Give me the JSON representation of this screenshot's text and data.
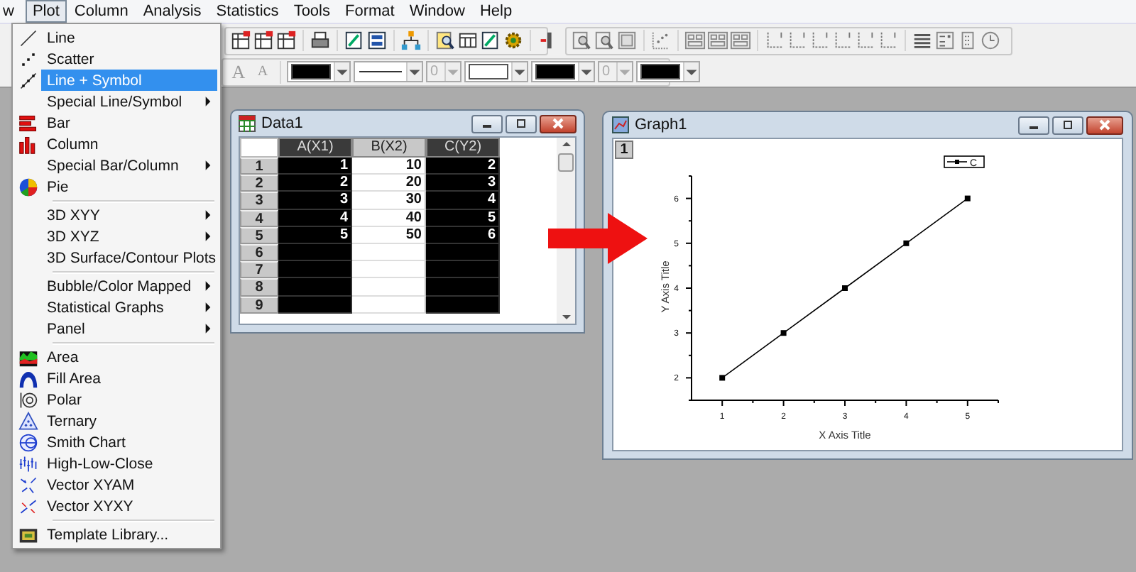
{
  "menubar": [
    {
      "label": "w",
      "selected": false
    },
    {
      "label": "Plot",
      "selected": true
    },
    {
      "label": "Column",
      "selected": false
    },
    {
      "label": "Analysis",
      "selected": false
    },
    {
      "label": "Statistics",
      "selected": false
    },
    {
      "label": "Tools",
      "selected": false
    },
    {
      "label": "Format",
      "selected": false
    },
    {
      "label": "Window",
      "selected": false
    },
    {
      "label": "Help",
      "selected": false
    }
  ],
  "toolbar": {
    "font_buttons": [
      "A",
      "A"
    ],
    "dropdowns": [
      {
        "kind": "color",
        "color": "#000000"
      },
      {
        "kind": "line"
      },
      {
        "kind": "number",
        "value": "0",
        "disabled": true
      },
      {
        "kind": "color",
        "color": "#ffffff"
      },
      {
        "kind": "color",
        "color": "#000000"
      },
      {
        "kind": "number",
        "value": "0",
        "disabled": true
      },
      {
        "kind": "color",
        "color": "#000000"
      }
    ]
  },
  "plot_menu": {
    "groups": [
      [
        {
          "label": "Line",
          "submenu": false,
          "selected": false
        },
        {
          "label": "Scatter",
          "submenu": false,
          "selected": false
        },
        {
          "label": "Line + Symbol",
          "submenu": false,
          "selected": true
        },
        {
          "label": "Special Line/Symbol",
          "submenu": true,
          "selected": false
        },
        {
          "label": "Bar",
          "submenu": false,
          "selected": false
        },
        {
          "label": "Column",
          "submenu": false,
          "selected": false
        },
        {
          "label": "Special Bar/Column",
          "submenu": true,
          "selected": false
        },
        {
          "label": "Pie",
          "submenu": false,
          "selected": false
        }
      ],
      [
        {
          "label": "3D XYY",
          "submenu": true,
          "selected": false
        },
        {
          "label": "3D XYZ",
          "submenu": true,
          "selected": false
        },
        {
          "label": "3D Surface/Contour Plots",
          "submenu": false,
          "selected": false
        }
      ],
      [
        {
          "label": "Bubble/Color Mapped",
          "submenu": true,
          "selected": false
        },
        {
          "label": "Statistical Graphs",
          "submenu": true,
          "selected": false
        },
        {
          "label": "Panel",
          "submenu": true,
          "selected": false
        }
      ],
      [
        {
          "label": "Area",
          "submenu": false,
          "selected": false
        },
        {
          "label": "Fill Area",
          "submenu": false,
          "selected": false
        },
        {
          "label": "Polar",
          "submenu": false,
          "selected": false
        },
        {
          "label": "Ternary",
          "submenu": false,
          "selected": false
        },
        {
          "label": "Smith Chart",
          "submenu": false,
          "selected": false
        },
        {
          "label": "High-Low-Close",
          "submenu": false,
          "selected": false
        },
        {
          "label": "Vector XYAM",
          "submenu": false,
          "selected": false
        },
        {
          "label": "Vector XYXY",
          "submenu": false,
          "selected": false
        }
      ],
      [
        {
          "label": "Template Library...",
          "submenu": false,
          "selected": false
        }
      ]
    ]
  },
  "worksheet": {
    "title": "Data1",
    "columns": [
      {
        "label": "A(X1)",
        "selected": true
      },
      {
        "label": "B(X2)",
        "selected": false
      },
      {
        "label": "C(Y2)",
        "selected": true
      }
    ],
    "rows": [
      {
        "label": "1",
        "cells": [
          "1",
          "10",
          "2"
        ]
      },
      {
        "label": "2",
        "cells": [
          "2",
          "20",
          "3"
        ]
      },
      {
        "label": "3",
        "cells": [
          "3",
          "30",
          "4"
        ]
      },
      {
        "label": "4",
        "cells": [
          "4",
          "40",
          "5"
        ]
      },
      {
        "label": "5",
        "cells": [
          "5",
          "50",
          "6"
        ]
      },
      {
        "label": "6"
      },
      {
        "label": "7"
      },
      {
        "label": "8"
      },
      {
        "label": "9"
      }
    ]
  },
  "graph": {
    "title": "Graph1",
    "layer": "1",
    "chart_data": {
      "type": "line",
      "xlabel": "X Axis Title",
      "ylabel": "Y Axis Title",
      "x": [
        1,
        2,
        3,
        4,
        5
      ],
      "series": [
        {
          "name": "C",
          "color": "#000000",
          "marker": "square",
          "values": [
            2,
            3,
            4,
            5,
            6
          ]
        }
      ],
      "xlim": [
        0.5,
        5.5
      ],
      "ylim": [
        1.5,
        6.5
      ],
      "xticks": [
        1,
        2,
        3,
        4,
        5
      ],
      "yticks": [
        2,
        3,
        4,
        5,
        6
      ]
    }
  }
}
